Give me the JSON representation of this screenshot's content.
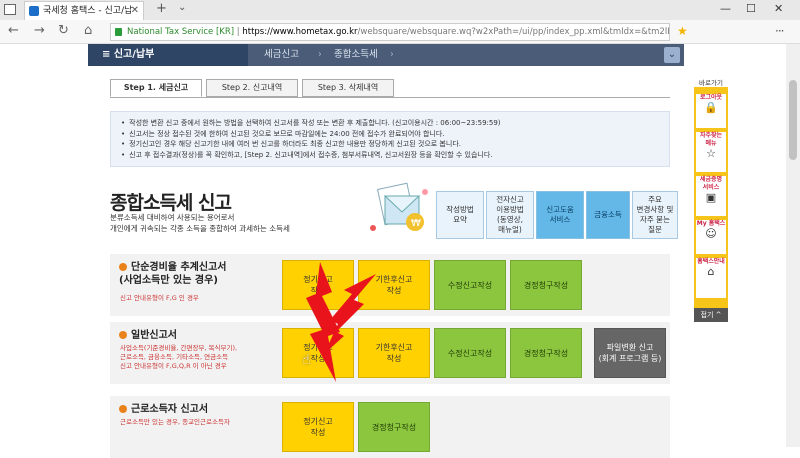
{
  "browser": {
    "tab_title": "국세청 홈택스 - 신고/납",
    "site_label": "National Tax Service [KR]",
    "url_host": "https://www.hometax.go.kr",
    "url_path": "/websquare/websquare.wq?w2xPath=/ui/pp/index_pp.xml&tmIdx=&tm2lIdx=&tm3lIdx="
  },
  "gnb": {
    "home": "≡  신고/납부",
    "crumb1": "세금신고",
    "crumb2": "종합소득세"
  },
  "tabs": [
    "Step 1. 세금신고",
    "Step 2. 신고내역",
    "Step 3. 삭제내역"
  ],
  "notice": [
    "작성한 변환 신고 중에서 원하는 방법을 선택하여 신고서를 작성 또는 변환 후 제출합니다. (신고이용시간 : 06:00~23:59:59)",
    "신고서는 정상 접수된 것에 한하여 신고된 것으로 보므로 마감일에는 24:00 전에 접수가 완료되어야 합니다.",
    "정기신고인 경우 해당 신고기한 내에 여러 번 신고를 하더라도 최종 신고한 내용만 정당하게 신고된 것으로 봅니다.",
    "신고 후 접수결과(정상)를 꼭 확인하고, [Step 2. 신고내역]에서 접수증, 첨부서류내역, 신고서원장 등을 확인할 수 있습니다."
  ],
  "page_title": "종합소득세 신고",
  "page_desc": [
    "분류소득세 대비하여 사용되는 용어로서",
    "개인에게 귀속되는 각종 소득을 종합하여 과세하는 소득세"
  ],
  "quick_buttons": [
    {
      "label": "작성방법\n요약",
      "style": "light"
    },
    {
      "label": "전자신고\n이용방법\n(동영상,\n매뉴얼)",
      "style": "light"
    },
    {
      "label": "신고도움\n서비스",
      "style": "blue"
    },
    {
      "label": "금융소득",
      "style": "blue"
    },
    {
      "label": "주요\n변경사항 및\n자주 묻는\n질문",
      "style": "light"
    }
  ],
  "sections": [
    {
      "title": "단순경비율 추계신고서\n(사업소득만 있는 경우)",
      "notes": [
        "신고 안내유형이 F,G 인 경우"
      ],
      "buttons": [
        {
          "label": "정기신고\n작성",
          "color": "yellow"
        },
        {
          "label": "기한후신고\n작성",
          "color": "yellow"
        },
        {
          "label": "수정신고작성",
          "color": "green"
        },
        {
          "label": "경정청구작성",
          "color": "green"
        }
      ]
    },
    {
      "title": "일반신고서",
      "notes": [
        "사업소득(기준경비율, 간편장부, 복식부기),",
        "근로소득, 금융소득, 기타소득, 연금소득",
        "신고 안내유형이 F,G,Q,R 이 아닌 경우"
      ],
      "buttons": [
        {
          "label": "정기신고\n작성",
          "color": "yellow"
        },
        {
          "label": "기한후신고\n작성",
          "color": "yellow"
        },
        {
          "label": "수정신고작성",
          "color": "green"
        },
        {
          "label": "경정청구작성",
          "color": "green"
        },
        {
          "label": "파일변환 신고\n(회계 프로그램 등)",
          "color": "gray"
        }
      ]
    },
    {
      "title": "근로소득자 신고서",
      "notes": [
        "근로소득만 있는 경우, 종교인근로소득자"
      ],
      "buttons": [
        {
          "label": "정기신고\n작성",
          "color": "yellow"
        },
        {
          "label": "경정청구작성",
          "color": "green"
        }
      ]
    }
  ],
  "quick_menu": {
    "head": "바로가기",
    "items": [
      {
        "label": "로그아웃",
        "icon": "lock-icon"
      },
      {
        "label": "자주찾는\n메뉴",
        "icon": "star-icon"
      },
      {
        "label": "세금증명\n서비스",
        "icon": "certificate-icon"
      },
      {
        "label": "My 홈택스",
        "icon": "person-icon"
      },
      {
        "label": "홈택스안내",
        "icon": "home-icon"
      }
    ],
    "top": "접기 ^"
  },
  "colors": {
    "gnb": "#4a5c78",
    "yellow_button": "#ffd100",
    "green_button": "#8cc63f",
    "quick_menu": "#f7c41a"
  }
}
